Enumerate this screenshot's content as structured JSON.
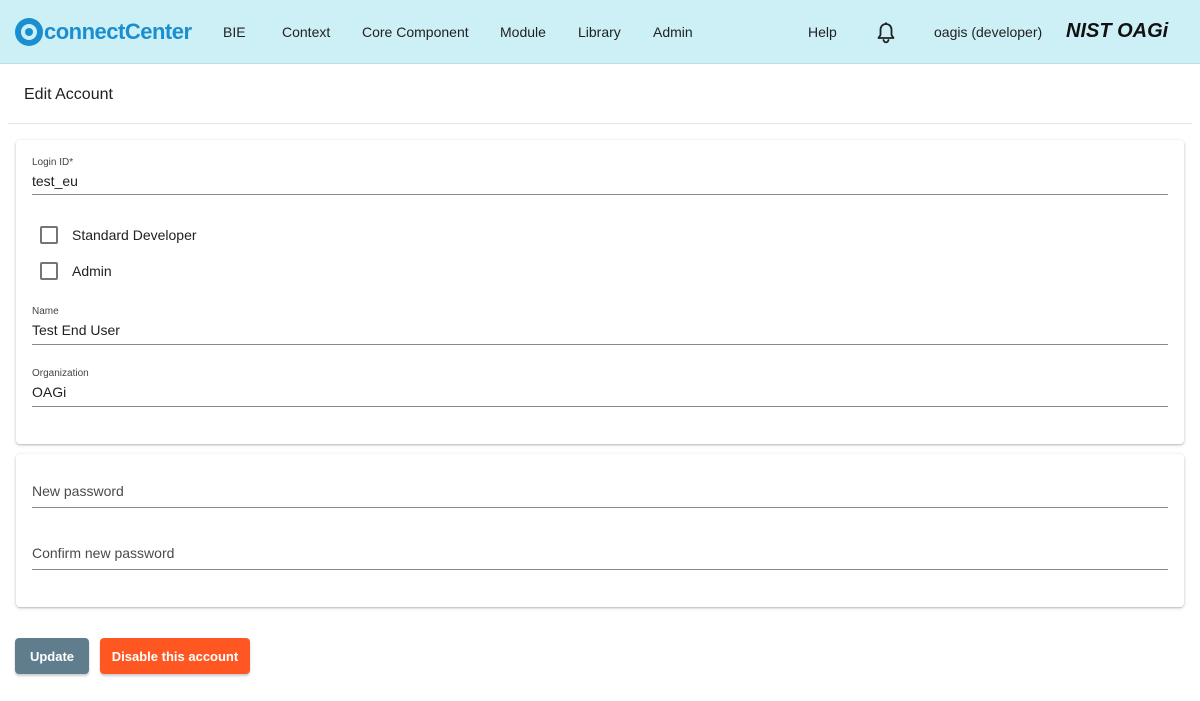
{
  "header": {
    "logo_text_a": "connect",
    "logo_text_b": "Center",
    "nav": [
      "BIE",
      "Context",
      "Core Component",
      "Module",
      "Library",
      "Admin"
    ],
    "help": "Help",
    "user": "oagis (developer)",
    "brand": "NIST OAGi",
    "bell_icon": "bell-icon"
  },
  "page": {
    "title": "Edit Account"
  },
  "account": {
    "login_id_label": "Login ID*",
    "login_id_value": "test_eu",
    "standard_developer_label": "Standard Developer",
    "standard_developer_checked": false,
    "admin_label": "Admin",
    "admin_checked": false,
    "name_label": "Name",
    "name_value": "Test End User",
    "organization_label": "Organization",
    "organization_value": "OAGi"
  },
  "password": {
    "new_placeholder": "New password",
    "confirm_placeholder": "Confirm new password"
  },
  "actions": {
    "update_label": "Update",
    "disable_label": "Disable this account"
  },
  "colors": {
    "topbar": "#cdf0f7",
    "brand_blue": "#1a8fd0",
    "update_button": "#5f7d8c",
    "disable_button": "#ff5722"
  }
}
